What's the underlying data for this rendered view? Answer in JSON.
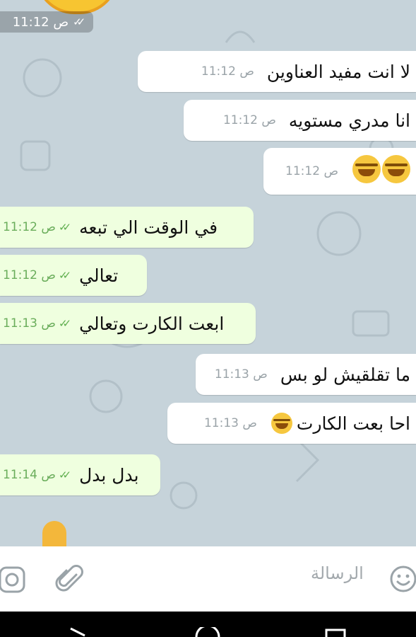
{
  "top_time": "11:12 ص",
  "messages": [
    {
      "type": "incoming",
      "text": "لا انت مفيد العناوين",
      "time": "11:12 ص"
    },
    {
      "type": "incoming",
      "text": "انا مدري مستويه",
      "time": "11:12 ص"
    },
    {
      "type": "incoming",
      "text": "",
      "emoji_count": 2,
      "time": "11:12 ص"
    },
    {
      "type": "outgoing",
      "text": "في الوقت الي تبعه",
      "time": "11:12 ص"
    },
    {
      "type": "outgoing",
      "text": "تعالي",
      "time": "11:12 ص"
    },
    {
      "type": "outgoing",
      "text": "ابعت الكارت وتعالي",
      "time": "11:13 ص"
    },
    {
      "type": "incoming",
      "text": "ما تقلقيش لو بس",
      "time": "11:13 ص"
    },
    {
      "type": "incoming",
      "text": "احا بعت الكارت",
      "emoji_prefix": true,
      "time": "11:13 ص"
    },
    {
      "type": "outgoing",
      "text": "بدل بدل",
      "time": "11:14 ص"
    }
  ],
  "input": {
    "placeholder": "الرسالة"
  },
  "colors": {
    "incoming": "#ffffff",
    "outgoing": "#efffdf",
    "chat_bg": "#c6d3da",
    "tick": "#5fae4e"
  }
}
